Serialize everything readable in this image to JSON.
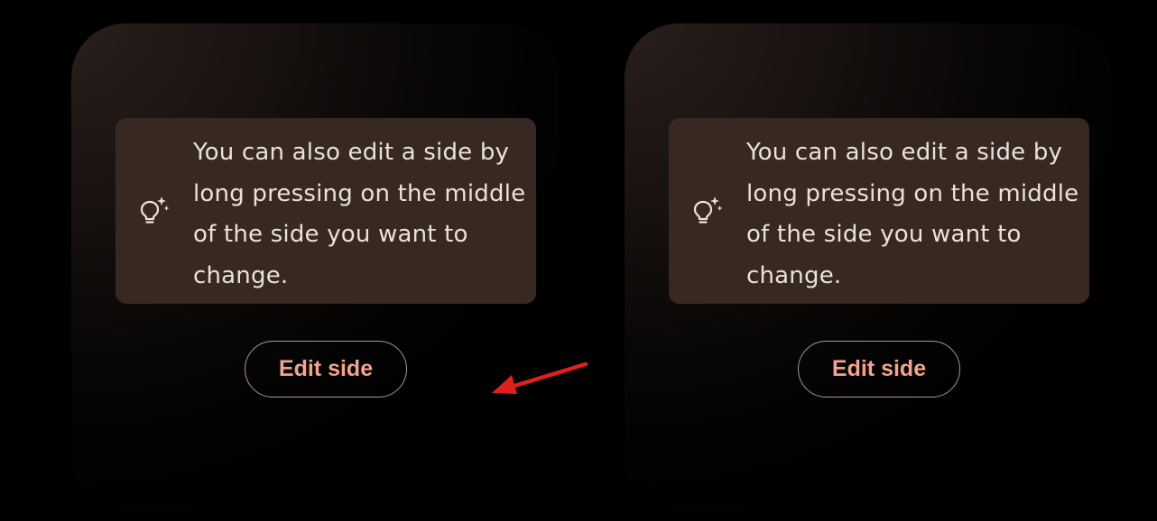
{
  "panels": [
    {
      "tip": {
        "icon": "lightbulb-sparkle-icon",
        "text": "You can also edit a side by long pressing on the middle of the side you want to change."
      },
      "button_label": "Edit side"
    },
    {
      "tip": {
        "icon": "lightbulb-sparkle-icon",
        "text": "You can also edit a side by long pressing on the middle of the side you want to change."
      },
      "button_label": "Edit side"
    }
  ],
  "annotation": {
    "icon": "red-arrow-icon",
    "color": "#e0201f"
  },
  "colors": {
    "background": "#000000",
    "card": "#372922",
    "tip_text": "#ece1da",
    "button_text": "#f2a48b",
    "button_border": "#a8978d"
  }
}
